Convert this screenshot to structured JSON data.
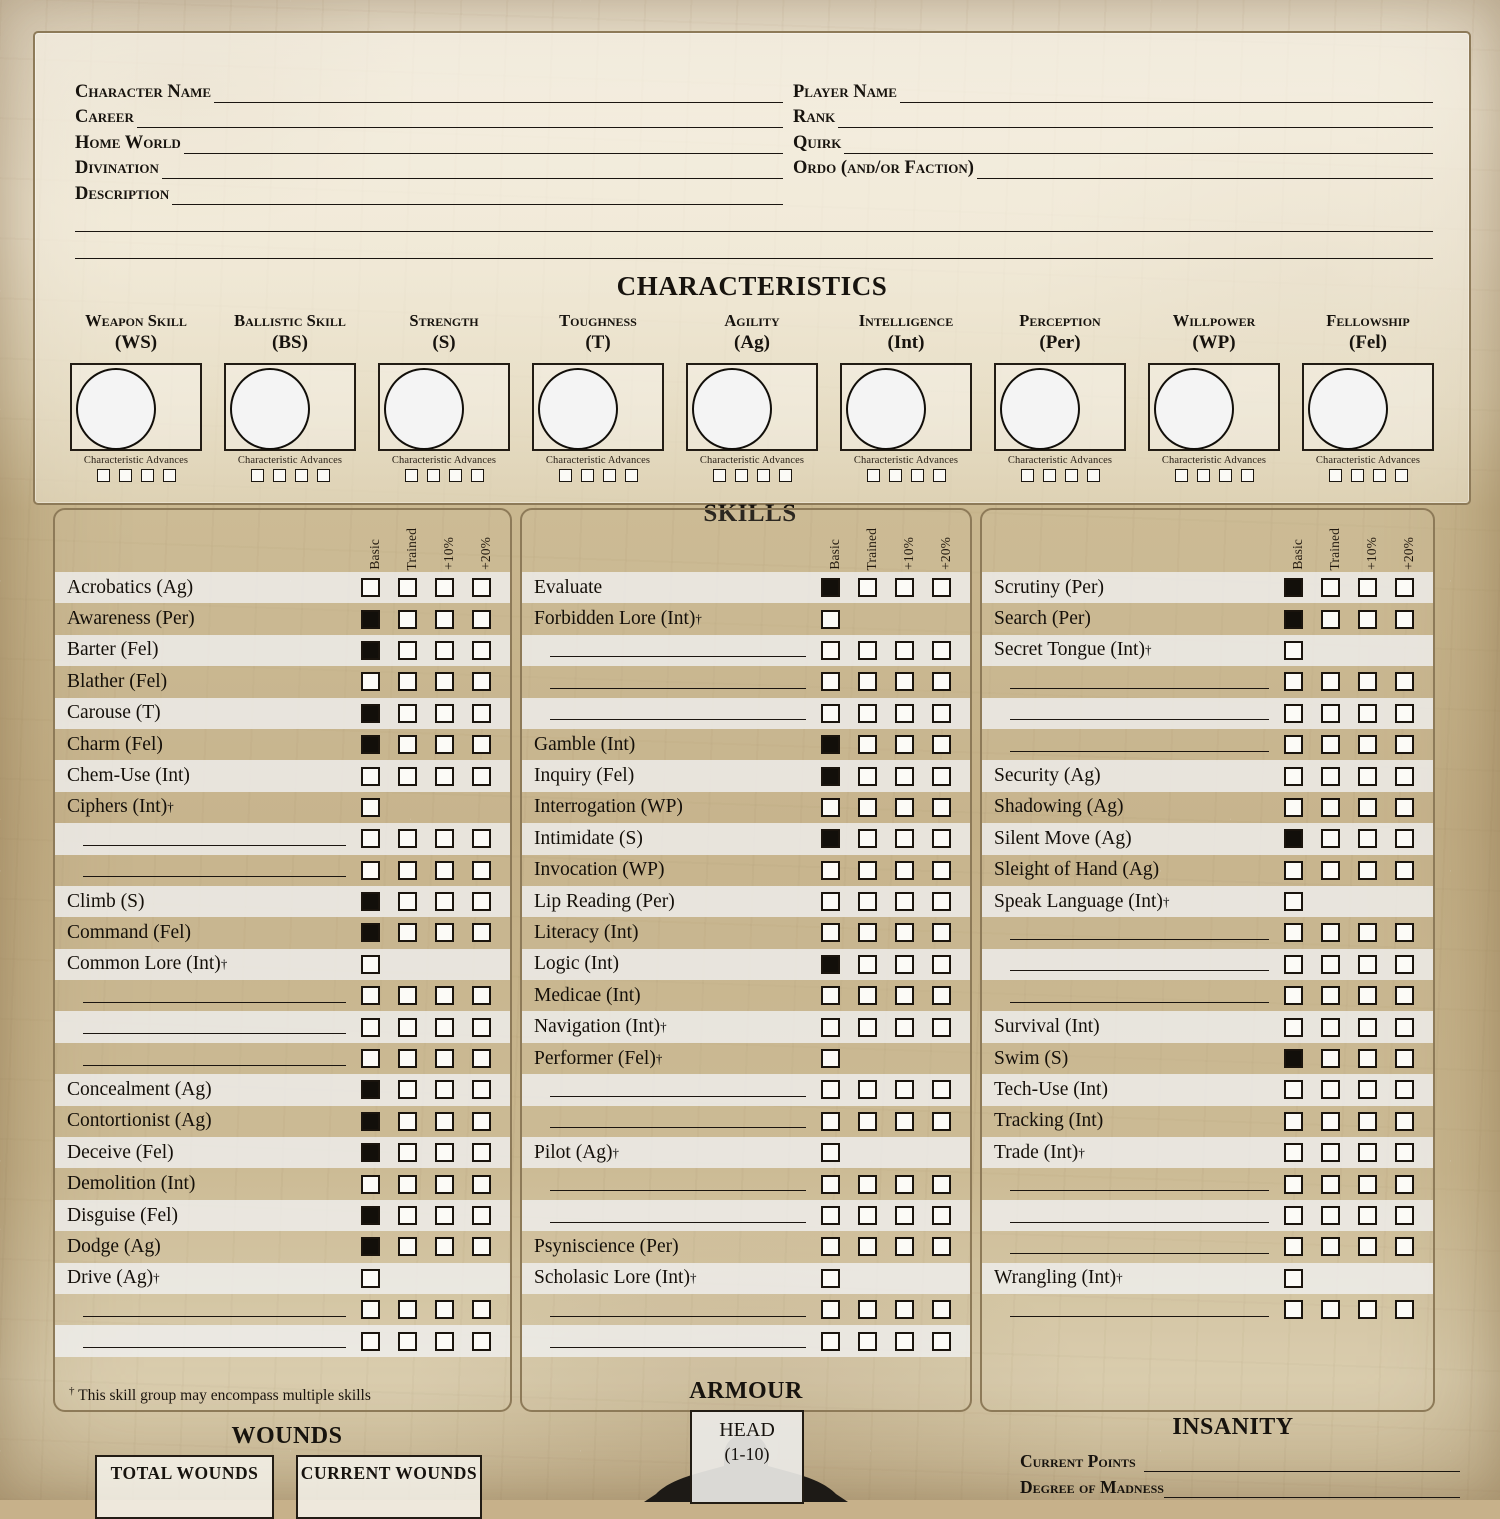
{
  "identity": {
    "left": [
      {
        "label": "Character Name",
        "value": ""
      },
      {
        "label": "Career",
        "value": ""
      },
      {
        "label": "Home World",
        "value": ""
      },
      {
        "label": "Divination",
        "value": ""
      },
      {
        "label": "Description",
        "value": ""
      }
    ],
    "right": [
      {
        "label": "Player Name",
        "value": ""
      },
      {
        "label": "Rank",
        "value": ""
      },
      {
        "label": "Quirk",
        "value": ""
      },
      {
        "label": "Ordo (and/or Faction)",
        "value": ""
      }
    ],
    "description_extra_lines": 2
  },
  "characteristics": {
    "title": "CHARACTERISTICS",
    "advances_label": "Characteristic Advances",
    "advance_boxes": 4,
    "items": [
      {
        "name": "Weapon Skill",
        "abbr": "(WS)",
        "value": ""
      },
      {
        "name": "Ballistic Skill",
        "abbr": "(BS)",
        "value": ""
      },
      {
        "name": "Strength",
        "abbr": "(S)",
        "value": ""
      },
      {
        "name": "Toughness",
        "abbr": "(T)",
        "value": ""
      },
      {
        "name": "Agility",
        "abbr": "(Ag)",
        "value": ""
      },
      {
        "name": "Intelligence",
        "abbr": "(Int)",
        "value": ""
      },
      {
        "name": "Perception",
        "abbr": "(Per)",
        "value": ""
      },
      {
        "name": "Willpower",
        "abbr": "(WP)",
        "value": ""
      },
      {
        "name": "Fellowship",
        "abbr": "(Fel)",
        "value": ""
      }
    ]
  },
  "skills": {
    "title": "SKILLS",
    "headers": [
      "Basic",
      "Trained",
      "+10%",
      "+20%"
    ],
    "footnote": "This skill group may encompass multiple skills",
    "footnote_marker": "†",
    "columns": [
      {
        "rows": [
          {
            "name": "Acrobatics (Ag)",
            "boxes": [
              false,
              false,
              false,
              false
            ]
          },
          {
            "name": "Awareness (Per)",
            "boxes": [
              true,
              false,
              false,
              false
            ]
          },
          {
            "name": "Barter (Fel)",
            "boxes": [
              true,
              false,
              false,
              false
            ]
          },
          {
            "name": "Blather (Fel)",
            "boxes": [
              false,
              false,
              false,
              false
            ]
          },
          {
            "name": "Carouse (T)",
            "boxes": [
              true,
              false,
              false,
              false
            ]
          },
          {
            "name": "Charm (Fel)",
            "boxes": [
              true,
              false,
              false,
              false
            ]
          },
          {
            "name": "Chem-Use (Int)",
            "boxes": [
              false,
              false,
              false,
              false
            ]
          },
          {
            "name": "Ciphers (Int)",
            "group": true,
            "boxes": [
              false
            ]
          },
          {
            "blank": true,
            "boxes": [
              false,
              false,
              false,
              false
            ]
          },
          {
            "blank": true,
            "boxes": [
              false,
              false,
              false,
              false
            ]
          },
          {
            "name": "Climb (S)",
            "boxes": [
              true,
              false,
              false,
              false
            ]
          },
          {
            "name": "Command (Fel)",
            "boxes": [
              true,
              false,
              false,
              false
            ]
          },
          {
            "name": "Common Lore (Int)",
            "group": true,
            "boxes": [
              false
            ]
          },
          {
            "blank": true,
            "boxes": [
              false,
              false,
              false,
              false
            ]
          },
          {
            "blank": true,
            "boxes": [
              false,
              false,
              false,
              false
            ]
          },
          {
            "blank": true,
            "boxes": [
              false,
              false,
              false,
              false
            ]
          },
          {
            "name": "Concealment (Ag)",
            "boxes": [
              true,
              false,
              false,
              false
            ]
          },
          {
            "name": "Contortionist (Ag)",
            "boxes": [
              true,
              false,
              false,
              false
            ]
          },
          {
            "name": "Deceive (Fel)",
            "boxes": [
              true,
              false,
              false,
              false
            ]
          },
          {
            "name": "Demolition (Int)",
            "boxes": [
              false,
              false,
              false,
              false
            ]
          },
          {
            "name": "Disguise (Fel)",
            "boxes": [
              true,
              false,
              false,
              false
            ]
          },
          {
            "name": "Dodge (Ag)",
            "boxes": [
              true,
              false,
              false,
              false
            ]
          },
          {
            "name": "Drive (Ag)",
            "group": true,
            "boxes": [
              false
            ]
          },
          {
            "blank": true,
            "boxes": [
              false,
              false,
              false,
              false
            ]
          },
          {
            "blank": true,
            "boxes": [
              false,
              false,
              false,
              false
            ]
          }
        ]
      },
      {
        "rows": [
          {
            "name": "Evaluate",
            "boxes": [
              true,
              false,
              false,
              false
            ]
          },
          {
            "name": "Forbidden Lore (Int)",
            "group": true,
            "boxes": [
              false
            ]
          },
          {
            "blank": true,
            "boxes": [
              false,
              false,
              false,
              false
            ]
          },
          {
            "blank": true,
            "boxes": [
              false,
              false,
              false,
              false
            ]
          },
          {
            "blank": true,
            "boxes": [
              false,
              false,
              false,
              false
            ]
          },
          {
            "name": "Gamble (Int)",
            "boxes": [
              true,
              false,
              false,
              false
            ]
          },
          {
            "name": "Inquiry (Fel)",
            "boxes": [
              true,
              false,
              false,
              false
            ]
          },
          {
            "name": "Interrogation (WP)",
            "boxes": [
              false,
              false,
              false,
              false
            ]
          },
          {
            "name": "Intimidate (S)",
            "boxes": [
              true,
              false,
              false,
              false
            ]
          },
          {
            "name": "Invocation (WP)",
            "boxes": [
              false,
              false,
              false,
              false
            ]
          },
          {
            "name": "Lip Reading (Per)",
            "boxes": [
              false,
              false,
              false,
              false
            ]
          },
          {
            "name": "Literacy (Int)",
            "boxes": [
              false,
              false,
              false,
              false
            ]
          },
          {
            "name": "Logic (Int)",
            "boxes": [
              true,
              false,
              false,
              false
            ]
          },
          {
            "name": "Medicae (Int)",
            "boxes": [
              false,
              false,
              false,
              false
            ]
          },
          {
            "name": "Navigation (Int)",
            "group": true,
            "boxes": [
              false,
              false,
              false,
              false
            ]
          },
          {
            "name": "Performer (Fel)",
            "group": true,
            "boxes": [
              false
            ]
          },
          {
            "blank": true,
            "boxes": [
              false,
              false,
              false,
              false
            ]
          },
          {
            "blank": true,
            "boxes": [
              false,
              false,
              false,
              false
            ]
          },
          {
            "name": "Pilot (Ag)",
            "group": true,
            "boxes": [
              false
            ]
          },
          {
            "blank": true,
            "boxes": [
              false,
              false,
              false,
              false
            ]
          },
          {
            "blank": true,
            "boxes": [
              false,
              false,
              false,
              false
            ]
          },
          {
            "name": "Psyniscience (Per)",
            "boxes": [
              false,
              false,
              false,
              false
            ]
          },
          {
            "name": "Scholasic Lore (Int)",
            "group": true,
            "boxes": [
              false
            ]
          },
          {
            "blank": true,
            "boxes": [
              false,
              false,
              false,
              false
            ]
          },
          {
            "blank": true,
            "boxes": [
              false,
              false,
              false,
              false
            ]
          }
        ]
      },
      {
        "rows": [
          {
            "name": "Scrutiny (Per)",
            "boxes": [
              true,
              false,
              false,
              false
            ]
          },
          {
            "name": "Search (Per)",
            "boxes": [
              true,
              false,
              false,
              false
            ]
          },
          {
            "name": "Secret Tongue (Int)",
            "group": true,
            "boxes": [
              false
            ]
          },
          {
            "blank": true,
            "boxes": [
              false,
              false,
              false,
              false
            ]
          },
          {
            "blank": true,
            "boxes": [
              false,
              false,
              false,
              false
            ]
          },
          {
            "blank": true,
            "boxes": [
              false,
              false,
              false,
              false
            ]
          },
          {
            "name": "Security (Ag)",
            "boxes": [
              false,
              false,
              false,
              false
            ]
          },
          {
            "name": "Shadowing (Ag)",
            "boxes": [
              false,
              false,
              false,
              false
            ]
          },
          {
            "name": "Silent Move (Ag)",
            "boxes": [
              true,
              false,
              false,
              false
            ]
          },
          {
            "name": "Sleight of Hand (Ag)",
            "boxes": [
              false,
              false,
              false,
              false
            ]
          },
          {
            "name": "Speak Language (Int)",
            "group": true,
            "boxes": [
              false
            ]
          },
          {
            "blank": true,
            "boxes": [
              false,
              false,
              false,
              false
            ]
          },
          {
            "blank": true,
            "boxes": [
              false,
              false,
              false,
              false
            ]
          },
          {
            "blank": true,
            "boxes": [
              false,
              false,
              false,
              false
            ]
          },
          {
            "name": "Survival (Int)",
            "boxes": [
              false,
              false,
              false,
              false
            ]
          },
          {
            "name": "Swim (S)",
            "boxes": [
              true,
              false,
              false,
              false
            ]
          },
          {
            "name": "Tech-Use (Int)",
            "boxes": [
              false,
              false,
              false,
              false
            ]
          },
          {
            "name": "Tracking (Int)",
            "boxes": [
              false,
              false,
              false,
              false
            ]
          },
          {
            "name": "Trade (Int)",
            "group": true,
            "boxes": [
              false,
              false,
              false,
              false
            ]
          },
          {
            "blank": true,
            "boxes": [
              false,
              false,
              false,
              false
            ]
          },
          {
            "blank": true,
            "boxes": [
              false,
              false,
              false,
              false
            ]
          },
          {
            "blank": true,
            "boxes": [
              false,
              false,
              false,
              false
            ]
          },
          {
            "name": "Wrangling (Int)",
            "group": true,
            "boxes": [
              false
            ]
          },
          {
            "blank": true,
            "boxes": [
              false,
              false,
              false,
              false
            ]
          }
        ]
      }
    ]
  },
  "wounds": {
    "title": "WOUNDS",
    "total_label": "TOTAL WOUNDS",
    "current_label": "CURRENT WOUNDS",
    "total_value": "",
    "current_value": ""
  },
  "armour": {
    "title": "ARMOUR",
    "head_label": "HEAD",
    "head_range": "(1-10)",
    "head_value": ""
  },
  "insanity": {
    "title": "INSANITY",
    "fields": [
      {
        "label": "Current Points",
        "value": ""
      },
      {
        "label": "Degree of Madness",
        "value": ""
      }
    ]
  }
}
